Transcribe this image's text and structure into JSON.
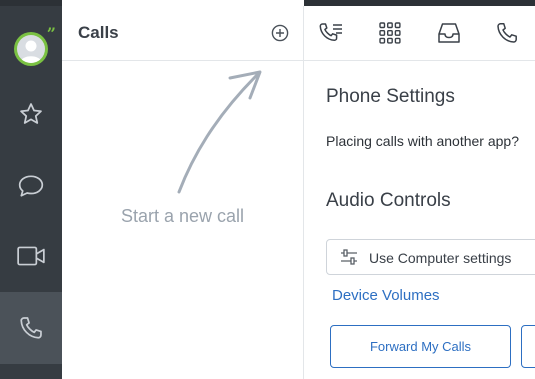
{
  "rail": {
    "items": [
      {
        "name": "favorites",
        "icon": "star-icon",
        "active": false
      },
      {
        "name": "messages",
        "icon": "chat-bubble-icon",
        "active": false
      },
      {
        "name": "video",
        "icon": "video-camera-icon",
        "active": false
      },
      {
        "name": "calls",
        "icon": "phone-icon",
        "active": true
      }
    ]
  },
  "calls_panel": {
    "title": "Calls",
    "empty_text": "Start a new call"
  },
  "toolbar": {
    "icons": [
      "call-history-icon",
      "dialpad-icon",
      "voicemail-inbox-icon",
      "phone-icon"
    ]
  },
  "settings": {
    "phone_heading": "Phone Settings",
    "placing_text": "Placing calls with another app?",
    "audio_heading": "Audio Controls",
    "audio_select_value": "Use Computer settings",
    "device_volumes_link": "Device Volumes",
    "forward_button": "Forward My Calls"
  },
  "colors": {
    "rail_bg": "#363c42",
    "rail_active": "#4b5259",
    "presence_green": "#7ac142",
    "link_blue": "#2d6fc2"
  }
}
